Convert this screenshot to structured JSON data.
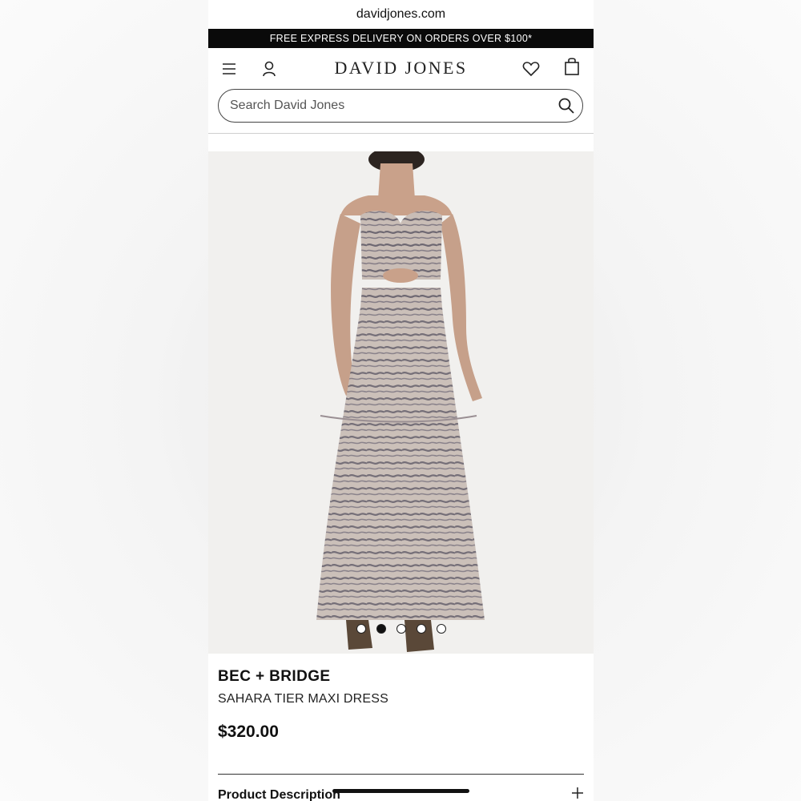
{
  "browser": {
    "url": "davidjones.com"
  },
  "promo": {
    "text": "FREE EXPRESS DELIVERY ON ORDERS OVER $100*"
  },
  "header": {
    "logo": "DAVID JONES",
    "icons": [
      "menu-icon",
      "account-icon",
      "wishlist-icon",
      "bag-icon"
    ]
  },
  "search": {
    "placeholder": "Search David Jones"
  },
  "gallery": {
    "image_count": 5,
    "active_index": 1
  },
  "product": {
    "brand": "BEC + BRIDGE",
    "name": "SAHARA TIER MAXI DRESS",
    "price": "$320.00"
  },
  "sections": {
    "description_label": "Product Description"
  },
  "colors": {
    "promo_bg": "#0a0a0a",
    "dress": "#a99c97",
    "image_bg": "#f1f0ee"
  }
}
